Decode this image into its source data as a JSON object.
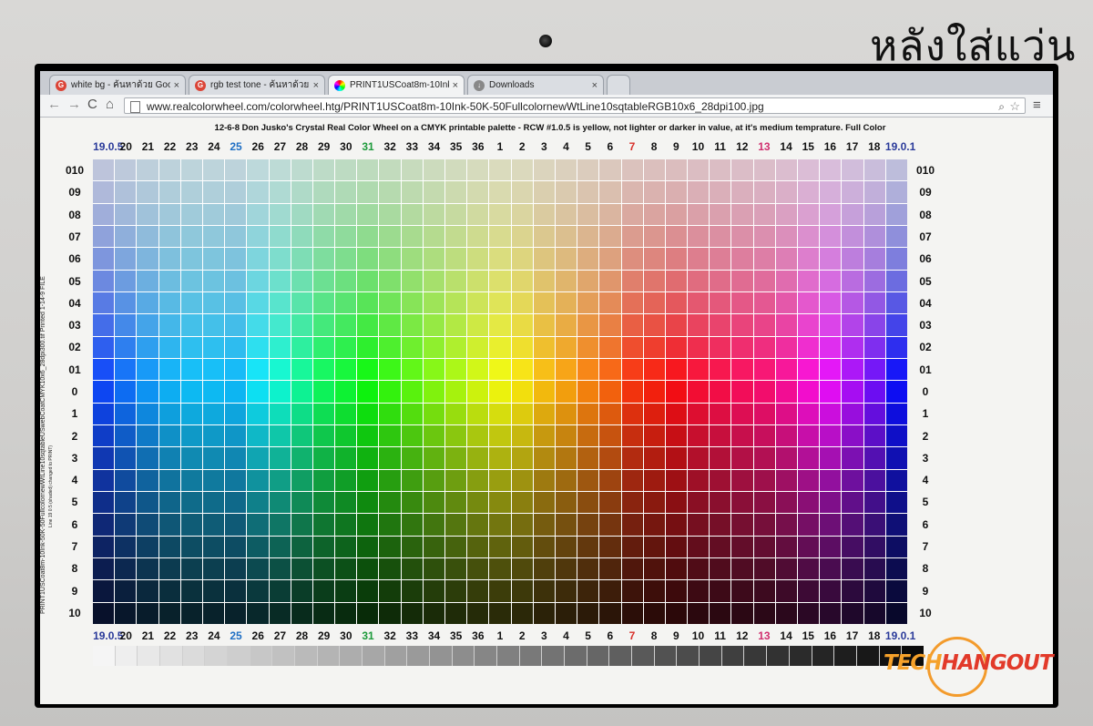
{
  "photo_caption": "หลังใส่แว่น",
  "browser": {
    "tabs": [
      {
        "label": "white bg - ค้นหาด้วย Goog",
        "icon": "google-icon"
      },
      {
        "label": "rgb test tone - ค้นหาด้วย G",
        "icon": "google-icon"
      },
      {
        "label": "PRINT1USCoat8m-10Ink-5",
        "icon": "colorwheel-icon",
        "active": true
      },
      {
        "label": "Downloads",
        "icon": "download-icon"
      }
    ],
    "url": "www.realcolorwheel.com/colorwheel.htg/PRINT1USCoat8m-10Ink-50K-50FullcolornewWtLine10sqtableRGB10x6_28dpi100.jpg"
  },
  "chart": {
    "title": "12-6-8   Don Jusko's Crystal Real Color Wheel on a CMYK printable palette - RCW #1.0.5 is yellow, not lighter or darker in value, at it's medium temprature.   Full Color",
    "column_labels": [
      "19.0.5",
      "20",
      "21",
      "22",
      "23",
      "24",
      "25",
      "26",
      "27",
      "28",
      "29",
      "30",
      "31",
      "32",
      "33",
      "34",
      "35",
      "36",
      "1",
      "2",
      "3",
      "4",
      "5",
      "6",
      "7",
      "8",
      "9",
      "10",
      "11",
      "12",
      "13",
      "14",
      "15",
      "16",
      "17",
      "18",
      "19.0.1"
    ],
    "row_labels": [
      "010",
      "09",
      "08",
      "07",
      "06",
      "05",
      "04",
      "03",
      "02",
      "01",
      "0",
      "1",
      "2",
      "3",
      "4",
      "5",
      "6",
      "7",
      "8",
      "9",
      "10"
    ],
    "side_text_1": "PRINT1USCoat8m-10Ink-50K-50FullcolornewWtLine10sqtableUSwebCoatCMYK10x6_28dpi300.tif   Printed 1-14-9 FILE",
    "side_text_2": "Line 19 0.5 (shaded) changed to PRINT)",
    "highlight_colors": {
      "25": "#1f6fc4",
      "31": "#1c9a3a",
      "7": "#d8302a",
      "13": "#d02e6e",
      "19.0.5": "#2a3a9a",
      "19.0.1": "#2a3a9a"
    }
  },
  "watermark": {
    "part1": "TECH",
    "part2": "HANGOUT"
  }
}
